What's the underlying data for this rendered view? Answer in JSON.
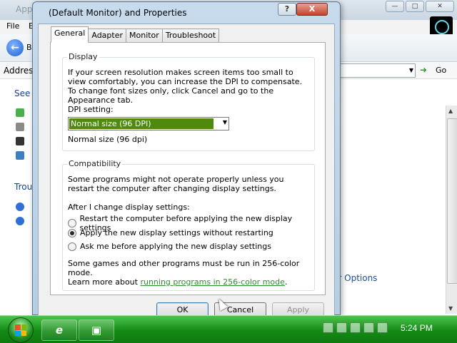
{
  "background_window": {
    "title": "App",
    "menu": {
      "file": "File",
      "edit": "E"
    },
    "toolbar": {
      "back_label": "B"
    },
    "address_label": "Address",
    "go_label": "Go",
    "sidebar": {
      "see_also": "See A",
      "troubleshoot": "Trou"
    },
    "more_options": "er Options"
  },
  "dialog": {
    "title": "(Default Monitor) and  Properties",
    "help_label": "?",
    "close_label": "X",
    "tabs": [
      {
        "label": "General"
      },
      {
        "label": "Adapter"
      },
      {
        "label": "Monitor"
      },
      {
        "label": "Troubleshoot"
      }
    ],
    "display": {
      "group_title": "Display",
      "description": "If your screen resolution makes screen items too small to view comfortably, you can increase the DPI to compensate.  To change font sizes only, click Cancel and go to the Appearance tab.",
      "dpi_label": "DPI setting:",
      "dpi_selected": "Normal size (96 DPI)",
      "dpi_note": "Normal size (96 dpi)"
    },
    "compatibility": {
      "group_title": "Compatibility",
      "description": "Some programs might not operate properly unless you restart the computer after changing display settings.",
      "after_change_label": "After I change display settings:",
      "options": [
        {
          "label": "Restart the computer before applying the new display settings",
          "checked": false
        },
        {
          "label": "Apply the new display settings without restarting",
          "checked": true
        },
        {
          "label": "Ask me before applying the new display settings",
          "checked": false
        }
      ],
      "footer_text": "Some games and other programs must be run in 256-color mode.",
      "learn_more_prefix": "Learn more about ",
      "learn_more_link": "running programs in 256-color mode",
      "learn_more_suffix": "."
    },
    "buttons": {
      "ok": "OK",
      "cancel": "Cancel",
      "apply": "Apply"
    }
  },
  "taskbar": {
    "clock": "5:24 PM",
    "ie_icon": "e"
  },
  "colors": {
    "taskbar": "#138a13",
    "selection": "#4f8a0f",
    "link": "#2e8a2e"
  }
}
